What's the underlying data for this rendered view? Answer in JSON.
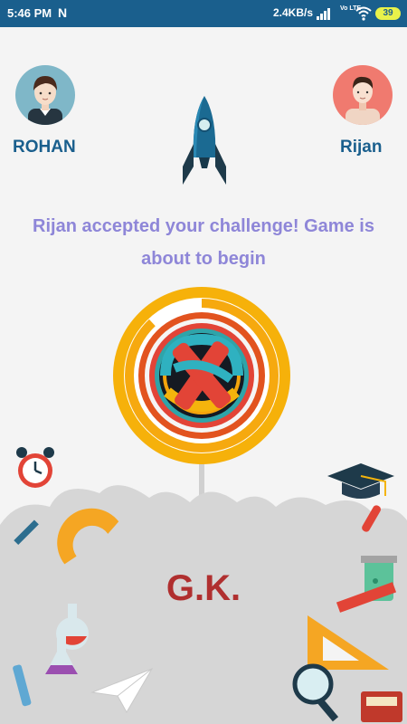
{
  "status_bar": {
    "time": "5:46 PM",
    "notification_icon": "N",
    "network_speed": "2.4KB/s",
    "network_type": "Vo LTE",
    "battery": "39"
  },
  "players": {
    "left": {
      "name": "ROHAN",
      "avatar_icon": "boy-avatar-icon",
      "ring_color": "#7fb7c8"
    },
    "right": {
      "name": "Rijan",
      "avatar_icon": "man-avatar-icon",
      "ring_color": "#f07a6f"
    }
  },
  "message": {
    "line1": "Rijan accepted your challenge! Game is",
    "line2": "about to begin"
  },
  "category": {
    "label": "G.K.",
    "icon": "category-logo-icon"
  },
  "progress": {
    "fraction": 0.88
  },
  "colors": {
    "status_bar": "#1a5f8d",
    "player_name": "#1a5f8d",
    "message": "#8e86d8",
    "category": "#b02f2f",
    "ring_outer": "#f5b301",
    "ring_accent": "#e0452a"
  },
  "decorations": [
    "rocket-icon",
    "alarm-clock-icon",
    "graduation-cap-icon",
    "protractor-icon",
    "flask-icon",
    "paper-plane-icon",
    "test-tube-icon",
    "pencil-icon",
    "triangle-ruler-icon",
    "magnifier-icon",
    "book-icon",
    "beaker-icon"
  ]
}
